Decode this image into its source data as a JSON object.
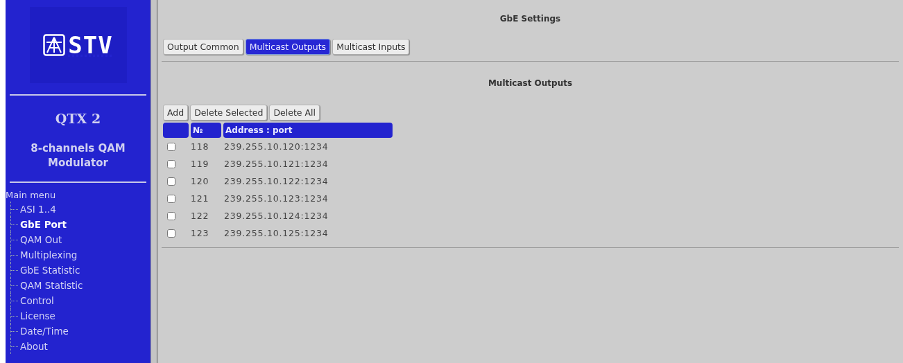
{
  "sidebar": {
    "logo": "STV",
    "product": "QTX 2",
    "description": "8-channels QAM Modulator",
    "menu_title": "Main menu",
    "items": [
      {
        "label": "ASI 1..4",
        "selected": false
      },
      {
        "label": "GbE Port",
        "selected": true
      },
      {
        "label": "QAM Out",
        "selected": false
      },
      {
        "label": "Multiplexing",
        "selected": false
      },
      {
        "label": "GbE Statistic",
        "selected": false
      },
      {
        "label": "QAM Statistic",
        "selected": false
      },
      {
        "label": "Control",
        "selected": false
      },
      {
        "label": "License",
        "selected": false
      },
      {
        "label": "Date/Time",
        "selected": false
      },
      {
        "label": "About",
        "selected": false
      }
    ]
  },
  "page_title": "GbE Settings",
  "tabs": [
    {
      "label": "Output Common",
      "selected": false
    },
    {
      "label": "Multicast Outputs",
      "selected": true
    },
    {
      "label": "Multicast Inputs",
      "selected": false
    }
  ],
  "section_title": "Multicast Outputs",
  "buttons": [
    "Add",
    "Delete Selected",
    "Delete All"
  ],
  "table": {
    "columns": [
      "№",
      "Address : port"
    ],
    "rows": [
      {
        "number": "118",
        "address": "239.255.10.120:1234",
        "checked": false
      },
      {
        "number": "119",
        "address": "239.255.10.121:1234",
        "checked": false
      },
      {
        "number": "120",
        "address": "239.255.10.122:1234",
        "checked": false
      },
      {
        "number": "121",
        "address": "239.255.10.123:1234",
        "checked": false
      },
      {
        "number": "122",
        "address": "239.255.10.124:1234",
        "checked": false
      },
      {
        "number": "123",
        "address": "239.255.10.125:1234",
        "checked": false
      }
    ]
  }
}
